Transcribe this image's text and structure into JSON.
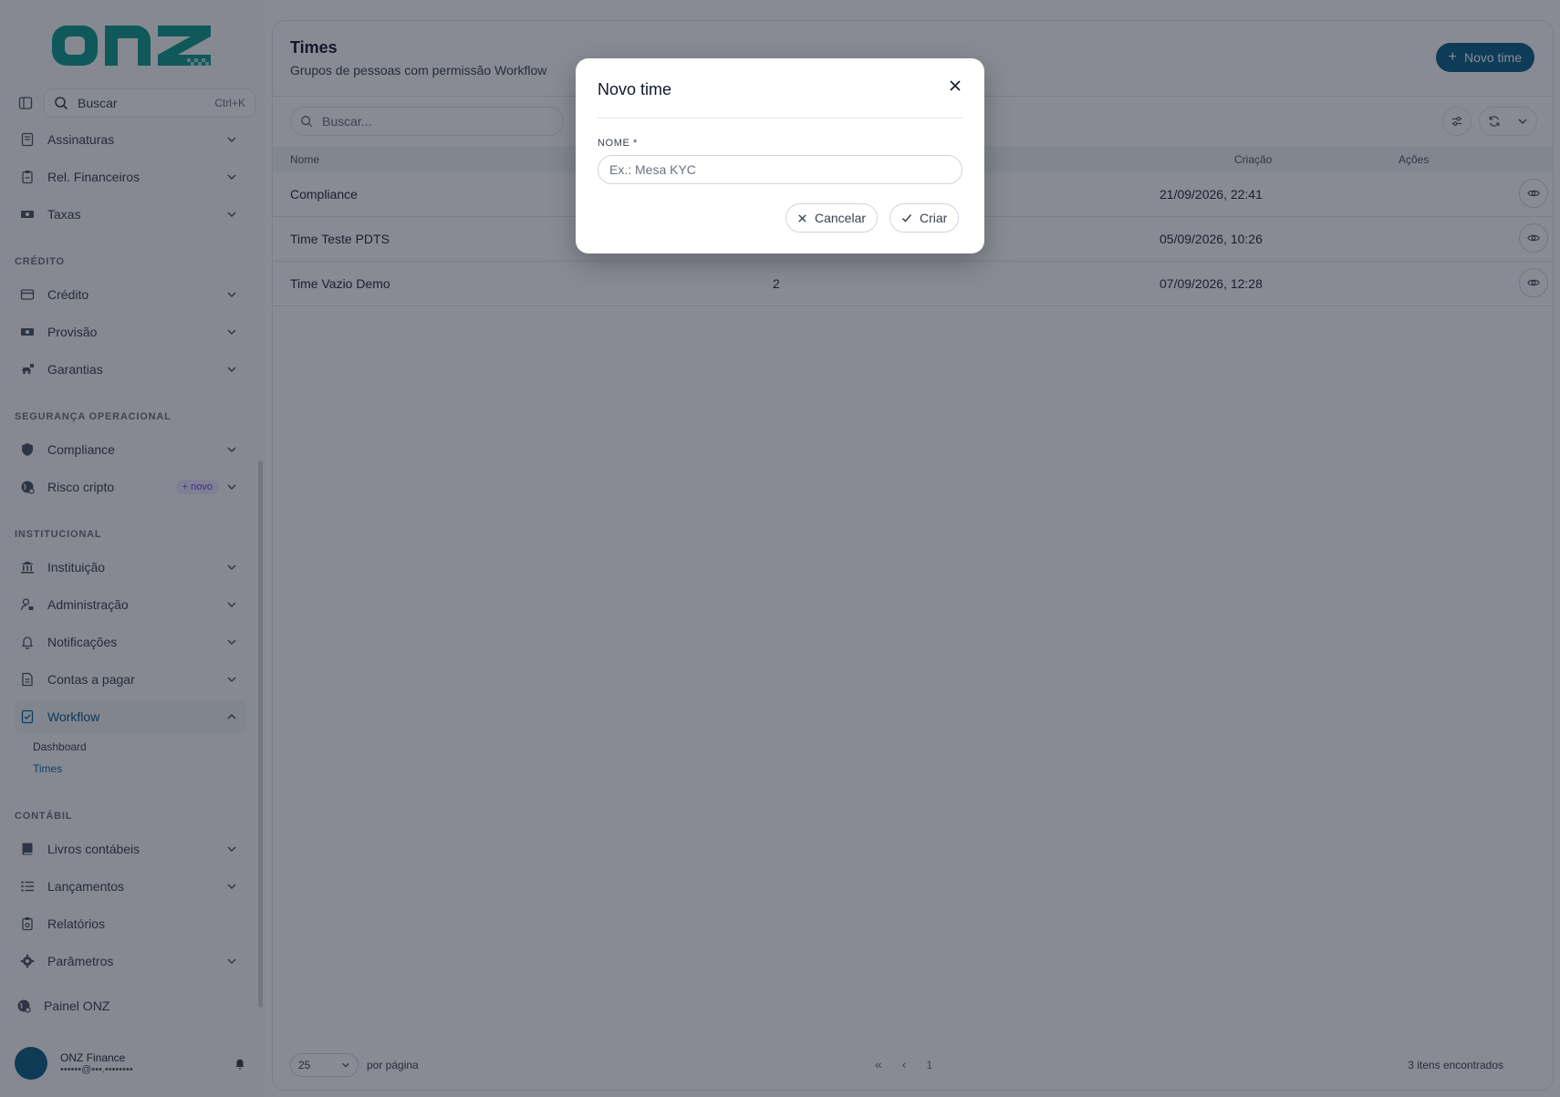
{
  "sidebar": {
    "logo_text": "onz",
    "search": {
      "label": "Buscar",
      "shortcut": "Ctrl+K"
    },
    "items_top": [
      {
        "label": "Assinaturas",
        "icon": "document-icon"
      },
      {
        "label": "Rel. Financeiros",
        "icon": "clipboard-icon"
      },
      {
        "label": "Taxas",
        "icon": "money-icon"
      }
    ],
    "sections": {
      "credito": "CRÉDITO",
      "seguranca": "SEGURANÇA OPERACIONAL",
      "institucional": "INSTITUCIONAL",
      "contabil": "CONTÁBIL"
    },
    "items_credito": [
      {
        "label": "Crédito"
      },
      {
        "label": "Provisão"
      },
      {
        "label": "Garantias"
      }
    ],
    "items_seguranca": [
      {
        "label": "Compliance"
      },
      {
        "label": "Risco cripto",
        "badge": "+ novo"
      }
    ],
    "items_institucional": [
      {
        "label": "Instituição"
      },
      {
        "label": "Administração"
      },
      {
        "label": "Notificações"
      },
      {
        "label": "Contas a pagar"
      },
      {
        "label": "Workflow"
      }
    ],
    "workflow_sub": [
      {
        "label": "Dashboard"
      },
      {
        "label": "Times"
      }
    ],
    "items_contabil": [
      {
        "label": "Livros contábeis"
      },
      {
        "label": "Lançamentos"
      },
      {
        "label": "Relatórios"
      },
      {
        "label": "Parâmetros"
      }
    ],
    "painel": "Painel ONZ",
    "user": {
      "name": "ONZ Finance",
      "email": "••••••@•••.••••••••"
    }
  },
  "main": {
    "title": "Times",
    "subtitle": "Grupos de pessoas com permissão Workflow",
    "new_button": "Novo time",
    "search_placeholder": "Buscar...",
    "columns": {
      "name": "Nome",
      "created": "Criação",
      "actions": "Ações"
    },
    "rows": [
      {
        "name": "Compliance",
        "members": "",
        "created": "21/09/2026, 22:41"
      },
      {
        "name": "Time Teste PDTS",
        "members": "",
        "created": "05/09/2026, 10:26"
      },
      {
        "name": "Time Vazio Demo",
        "members": "2",
        "created": "07/09/2026, 12:28"
      }
    ],
    "footer": {
      "per_page_value": "25",
      "per_page_label": "por página",
      "first": "«",
      "prev": "‹",
      "page": "1",
      "count": "3 itens encontrados"
    }
  },
  "modal": {
    "title": "Novo time",
    "field_label": "NOME  *",
    "field_placeholder": "Ex.: Mesa KYC",
    "field_value": "",
    "cancel": "Cancelar",
    "create": "Criar"
  },
  "colors": {
    "brand": "#0b5f86",
    "logo": "#0f9b8e",
    "overlay": "rgba(17,24,39,0.5)"
  }
}
